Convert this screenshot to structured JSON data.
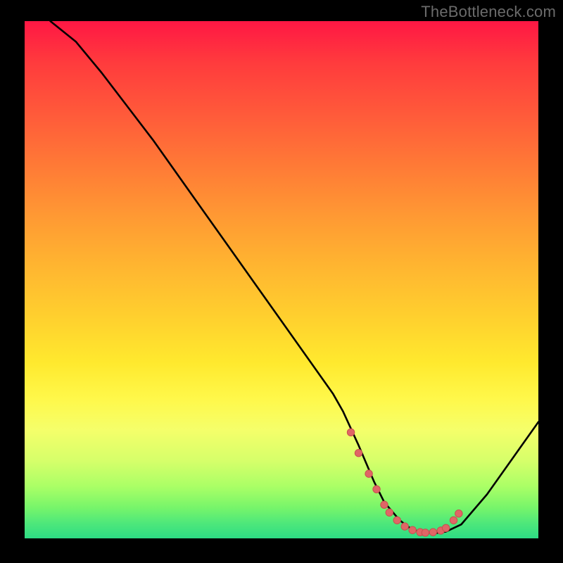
{
  "watermark": "TheBottleneck.com",
  "colors": {
    "background": "#000000",
    "gradient_top": "#ff1744",
    "gradient_bottom": "#2ddc84",
    "curve": "#000000",
    "marker_fill": "#e06666",
    "marker_stroke": "#c94f4f"
  },
  "chart_data": {
    "type": "line",
    "title": "",
    "xlabel": "",
    "ylabel": "",
    "xlim": [
      0,
      100
    ],
    "ylim": [
      0,
      100
    ],
    "grid": false,
    "series": [
      {
        "name": "bottleneck-curve",
        "x": [
          5,
          10,
          15,
          20,
          25,
          30,
          35,
          40,
          45,
          50,
          55,
          60,
          62,
          65,
          68,
          70,
          73,
          75,
          77,
          80,
          82,
          85,
          90,
          95,
          100
        ],
        "y": [
          100,
          96,
          90,
          83.5,
          77,
          70,
          63,
          56,
          49,
          42,
          35,
          28,
          24.5,
          18,
          11,
          7,
          3.5,
          2,
          1.2,
          1,
          1.3,
          2.7,
          8.5,
          15.5,
          22.5
        ]
      }
    ],
    "markers": {
      "name": "valley-dots",
      "x": [
        63.5,
        65,
        67,
        68.5,
        70,
        71,
        72.5,
        74,
        75.5,
        77,
        78,
        79.5,
        81,
        82,
        83.5,
        84.5
      ],
      "y": [
        20.5,
        16.5,
        12.5,
        9.5,
        6.5,
        5.0,
        3.5,
        2.3,
        1.6,
        1.2,
        1.1,
        1.2,
        1.5,
        2.0,
        3.5,
        4.8
      ]
    }
  }
}
